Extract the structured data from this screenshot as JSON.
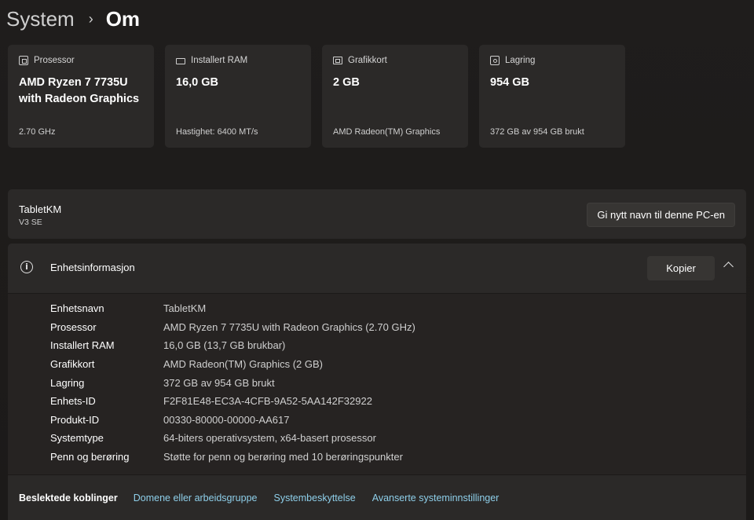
{
  "breadcrumb": {
    "parent": "System",
    "separator": "›",
    "current": "Om"
  },
  "cards": [
    {
      "icon": "processor-icon",
      "title": "Prosessor",
      "value": "AMD Ryzen 7 7735U with Radeon Graphics",
      "sub": "2.70 GHz"
    },
    {
      "icon": "ram-icon",
      "title": "Installert RAM",
      "value": "16,0 GB",
      "sub": "Hastighet: 6400 MT/s"
    },
    {
      "icon": "graphics-card-icon",
      "title": "Grafikkort",
      "value": "2 GB",
      "sub": "AMD Radeon(TM) Graphics"
    },
    {
      "icon": "storage-icon",
      "title": "Lagring",
      "value": "954 GB",
      "sub": "372 GB av 954 GB brukt"
    }
  ],
  "pc": {
    "name": "TabletKM",
    "model": "V3 SE",
    "rename_label": "Gi nytt navn til denne PC-en"
  },
  "device_info": {
    "title": "Enhetsinformasjon",
    "info_glyph": "i",
    "copy_label": "Kopier",
    "rows": [
      {
        "key": "Enhetsnavn",
        "value": "TabletKM"
      },
      {
        "key": "Prosessor",
        "value": "AMD Ryzen 7 7735U with Radeon Graphics (2.70 GHz)"
      },
      {
        "key": "Installert RAM",
        "value": "16,0 GB (13,7 GB brukbar)"
      },
      {
        "key": "Grafikkort",
        "value": "AMD Radeon(TM) Graphics (2 GB)"
      },
      {
        "key": "Lagring",
        "value": "372 GB av 954 GB brukt"
      },
      {
        "key": "Enhets-ID",
        "value": "F2F81E48-EC3A-4CFB-9A52-5AA142F32922"
      },
      {
        "key": "Produkt-ID",
        "value": "00330-80000-00000-AA617"
      },
      {
        "key": "Systemtype",
        "value": "64-biters operativsystem, x64-basert prosessor"
      },
      {
        "key": "Penn og berøring",
        "value": "Støtte for penn og berøring med 10 berøringspunkter"
      }
    ]
  },
  "related": {
    "label": "Beslektede koblinger",
    "links": [
      "Domene eller arbeidsgruppe",
      "Systembeskyttelse",
      "Avanserte systeminnstillinger"
    ]
  },
  "colors": {
    "background": "#1f1d1c",
    "card": "#2b2928",
    "link": "#8ecfea"
  }
}
